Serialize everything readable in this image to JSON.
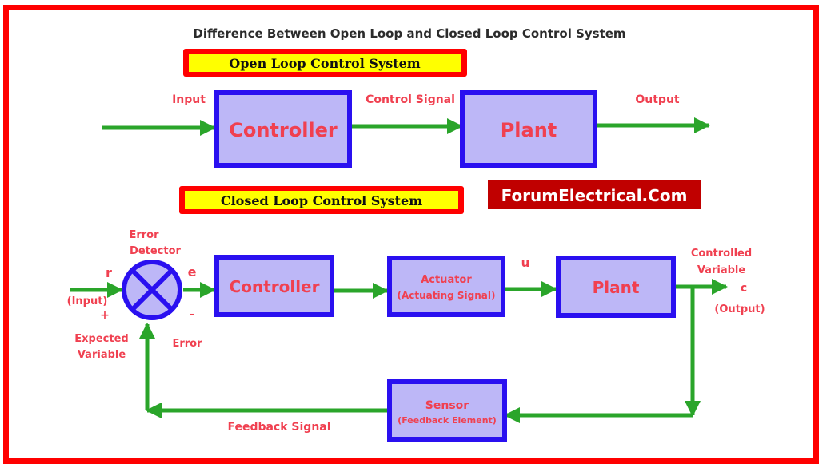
{
  "title": "Difference Between Open Loop and Closed Loop Control System",
  "brand": "ForumElectrical.Com",
  "colors": {
    "frame": "#ff0000",
    "block_fill": "#bdb7f7",
    "block_border": "#2a10f0",
    "arrow": "#2aa52a",
    "label": "#f04050",
    "banner_fill": "#ffff00",
    "banner_border": "#ff0000",
    "brand_fill": "#c00000"
  },
  "open_loop": {
    "banner": "Open Loop Control System",
    "input_label": "Input",
    "controller": "Controller",
    "signal_label": "Control Signal",
    "plant": "Plant",
    "output_label": "Output"
  },
  "closed_loop": {
    "banner": "Closed Loop Control System",
    "error_detector": [
      "Error",
      "Detector"
    ],
    "r": "r",
    "input_label": "(Input)",
    "plus": "+",
    "expected": [
      "Expected",
      "Variable"
    ],
    "e": "e",
    "minus": "-",
    "error": "Error",
    "controller": "Controller",
    "actuator": "Actuator",
    "actuator_sub": "(Actuating Signal)",
    "u": "u",
    "plant": "Plant",
    "controlled": [
      "Controlled",
      "Variable"
    ],
    "c": "c",
    "output_label": "(Output)",
    "sensor": "Sensor",
    "sensor_sub": "(Feedback Element)",
    "feedback_label": "Feedback Signal"
  }
}
